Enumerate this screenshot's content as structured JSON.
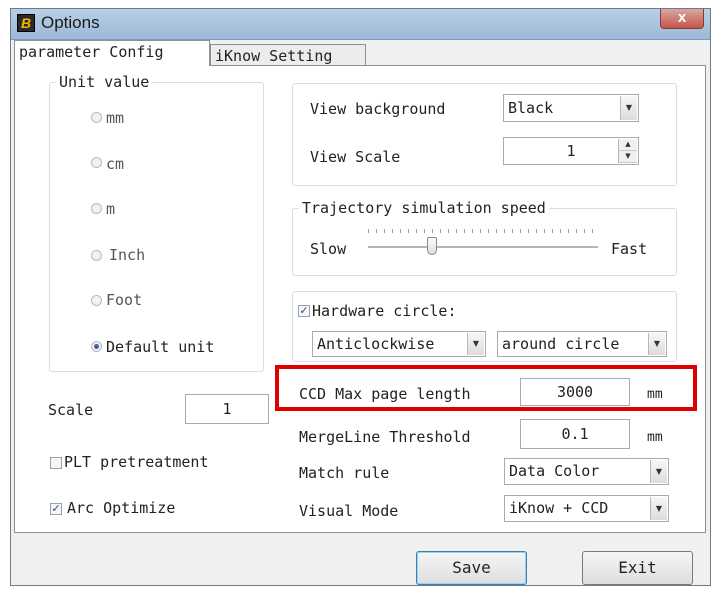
{
  "window": {
    "title": "Options",
    "app_icon_letter": "B",
    "close_label": "x"
  },
  "tabs": [
    {
      "label": "parameter Config",
      "active": true
    },
    {
      "label": "iKnow Setting",
      "active": false
    }
  ],
  "unit_value": {
    "title": "Unit value",
    "options": [
      {
        "label": "mm",
        "checked": false
      },
      {
        "label": "cm",
        "checked": false
      },
      {
        "label": "m",
        "checked": false
      },
      {
        "label": "Inch",
        "checked": false
      },
      {
        "label": "Foot",
        "checked": false
      },
      {
        "label": "Default unit",
        "checked": true
      }
    ]
  },
  "view": {
    "background_label": "View background",
    "background_value": "Black",
    "scale_label": "View Scale",
    "scale_value": "1"
  },
  "trajectory": {
    "title": "Trajectory simulation speed",
    "slow_label": "Slow",
    "fast_label": "Fast",
    "speed_fraction": 0.28
  },
  "hardware_circle": {
    "label": "Hardware circle:",
    "checked": true,
    "direction_value": "Anticlockwise",
    "mode_value": "around circle"
  },
  "ccd": {
    "max_page_label": "CCD Max page length",
    "max_page_value": "3000",
    "max_page_unit": "mm",
    "mergeline_label": "MergeLine Threshold",
    "mergeline_value": "0.1",
    "mergeline_unit": "mm",
    "match_rule_label": "Match rule",
    "match_rule_value": "Data Color",
    "visual_mode_label": "Visual Mode",
    "visual_mode_value": "iKnow + CCD"
  },
  "left": {
    "scale_label": "Scale",
    "scale_value": "1",
    "plt_label": "PLT pretreatment",
    "plt_checked": false,
    "arc_label": "Arc Optimize",
    "arc_checked": true
  },
  "buttons": {
    "save": "Save",
    "exit": "Exit"
  },
  "colors": {
    "highlight": "#e00000",
    "radio_selected": "#3a63a8"
  }
}
